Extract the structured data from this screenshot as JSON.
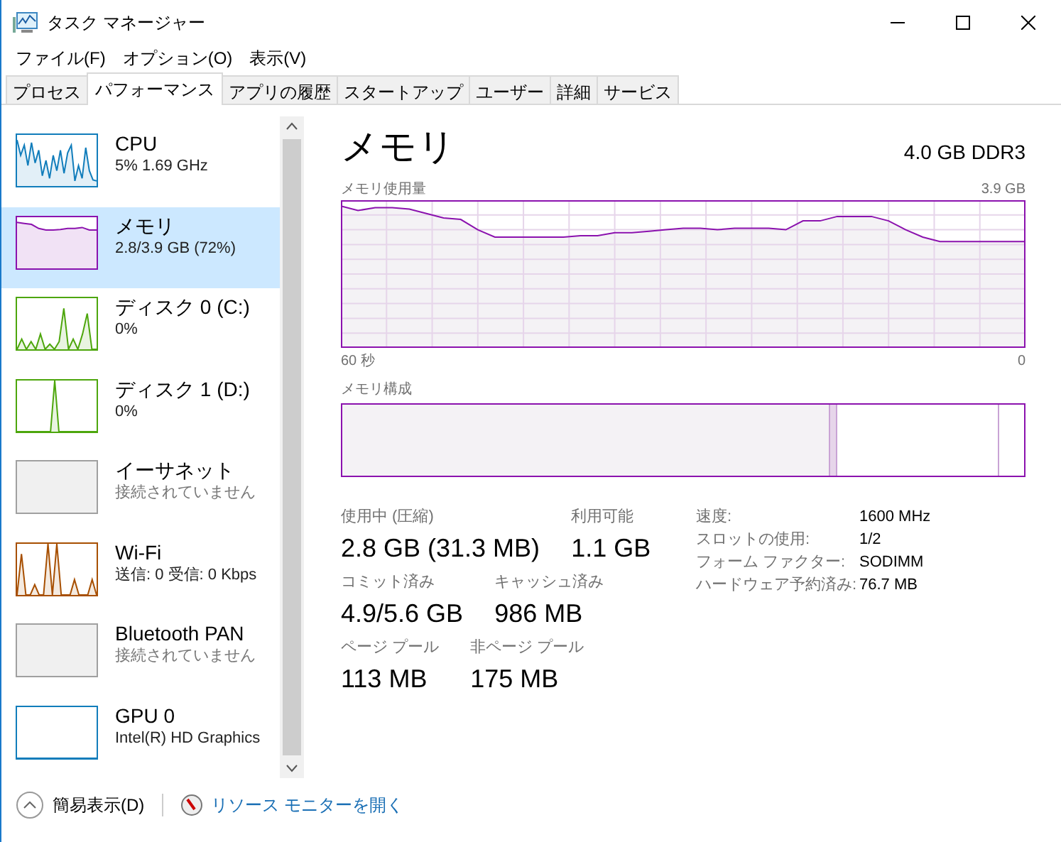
{
  "window": {
    "title": "タスク マネージャー"
  },
  "menu": [
    "ファイル(F)",
    "オプション(O)",
    "表示(V)"
  ],
  "tabs": [
    {
      "label": "プロセス",
      "selected": false
    },
    {
      "label": "パフォーマンス",
      "selected": true
    },
    {
      "label": "アプリの履歴",
      "selected": false
    },
    {
      "label": "スタートアップ",
      "selected": false
    },
    {
      "label": "ユーザー",
      "selected": false
    },
    {
      "label": "詳細",
      "selected": false
    },
    {
      "label": "サービス",
      "selected": false
    }
  ],
  "sidebar": {
    "items": [
      {
        "kind": "cpu",
        "name": "CPU",
        "detail": "5%  1.69 GHz",
        "color": "#117dbb",
        "selected": false
      },
      {
        "kind": "memory",
        "name": "メモリ",
        "detail": "2.8/3.9 GB (72%)",
        "color": "#8b12ae",
        "selected": true
      },
      {
        "kind": "disk",
        "name": "ディスク 0 (C:)",
        "detail": "0%",
        "color": "#4da60c",
        "selected": false
      },
      {
        "kind": "disk_idle",
        "name": "ディスク 1 (D:)",
        "detail": "0%",
        "color": "#4da60c",
        "selected": false
      },
      {
        "kind": "empty",
        "name": "イーサネット",
        "detail": "接続されていません",
        "color": "#a0a0a0",
        "selected": false
      },
      {
        "kind": "network",
        "name": "Wi-Fi",
        "detail": "送信: 0 受信: 0 Kbps",
        "color": "#a74f01",
        "selected": false
      },
      {
        "kind": "empty",
        "name": "Bluetooth PAN",
        "detail": "接続されていません",
        "color": "#a0a0a0",
        "selected": false
      },
      {
        "kind": "gpu",
        "name": "GPU 0",
        "detail": "Intel(R) HD Graphics",
        "color": "#117dbb",
        "selected": false
      }
    ]
  },
  "detail": {
    "title": "メモリ",
    "spec": "4.0 GB DDR3",
    "usage_chart": {
      "label": "メモリ使用量",
      "max": "3.9 GB",
      "x_start": "60 秒",
      "x_end": "0"
    },
    "composition": {
      "label": "メモリ構成"
    },
    "stats": [
      [
        {
          "label": "使用中 (圧縮)",
          "value": "2.8 GB (31.3 MB)"
        },
        {
          "label": "利用可能",
          "value": "1.1 GB"
        }
      ],
      [
        {
          "label": "コミット済み",
          "value": "4.9/5.6 GB"
        },
        {
          "label": "キャッシュ済み",
          "value": "986 MB"
        }
      ],
      [
        {
          "label": "ページ プール",
          "value": "113 MB"
        },
        {
          "label": "非ページ プール",
          "value": "175 MB"
        }
      ]
    ],
    "properties": [
      {
        "label": "速度:",
        "value": "1600 MHz"
      },
      {
        "label": "スロットの使用:",
        "value": "1/2"
      },
      {
        "label": "フォーム ファクター:",
        "value": "SODIMM"
      },
      {
        "label": "ハードウェア予約済み:",
        "value": "76.7 MB"
      }
    ]
  },
  "footer": {
    "fewer_details": "簡易表示(D)",
    "resource_monitor": "リソース モニターを開く"
  }
}
